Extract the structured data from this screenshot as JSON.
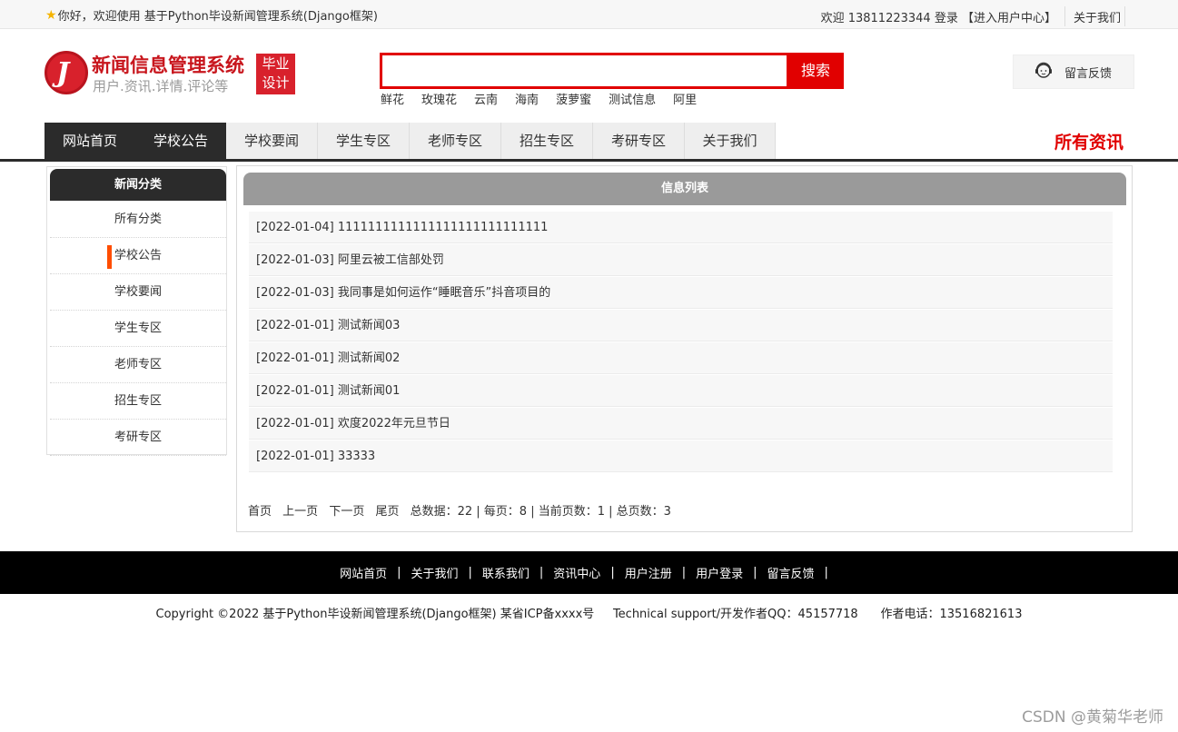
{
  "topbar": {
    "welcome_text": "你好，欢迎使用 基于Python毕设新闻管理系统(Django框架)",
    "user_greeting": "欢迎 13811223344 登录",
    "user_center_link": "【进入用户中心】",
    "about_link": "关于我们"
  },
  "logo": {
    "mark": "J",
    "title": "新闻信息管理系统",
    "subtitle": "用户.资讯.详情.评论等",
    "badge_line1": "毕业",
    "badge_line2": "设计"
  },
  "search": {
    "value": "",
    "button_label": "搜索",
    "hot_words": [
      "鲜花",
      "玫瑰花",
      "云南",
      "海南",
      "菠萝蜜",
      "测试信息",
      "阿里"
    ]
  },
  "feedback": {
    "label": "留言反馈",
    "icon": "customer-service-icon"
  },
  "nav": {
    "items": [
      "网站首页",
      "学校公告",
      "学校要闻",
      "学生专区",
      "老师专区",
      "招生专区",
      "考研专区",
      "关于我们"
    ],
    "all_news": "所有资讯"
  },
  "sidebar": {
    "title": "新闻分类",
    "categories": [
      "所有分类",
      "学校公告",
      "学校要闻",
      "学生专区",
      "老师专区",
      "招生专区",
      "考研专区"
    ],
    "active_index": 1
  },
  "main": {
    "title": "信息列表",
    "rows": [
      "[2022-01-04] 1111111111111111111111111111",
      "[2022-01-03] 阿里云被工信部处罚",
      "[2022-01-03] 我同事是如何运作“睡眠音乐”抖音项目的",
      "[2022-01-01] 测试新闻03",
      "[2022-01-01] 测试新闻02",
      "[2022-01-01] 测试新闻01",
      "[2022-01-01] 欢度2022年元旦节日",
      "[2022-01-01] 33333"
    ],
    "pager": {
      "first": "首页",
      "prev": "上一页",
      "next": "下一页",
      "last": "尾页",
      "stats": "总数据：22 | 每页：8 | 当前页数：1 | 总页数：3"
    }
  },
  "footer": {
    "links": [
      "网站首页",
      "关于我们",
      "联系我们",
      "资讯中心",
      "用户注册",
      "用户登录",
      "留言反馈"
    ],
    "separator": "|",
    "copyright": "Copyright ©2022 基于Python毕设新闻管理系统(Django框架) 某省ICP备xxxx号     Technical support/开发作者QQ：45157718      作者电话：13516821613"
  },
  "watermark": "CSDN @黄菊华老师",
  "colors": {
    "accent_red": "#e10000",
    "dark": "#2b2b2b",
    "active_marker": "#ff4d00"
  }
}
